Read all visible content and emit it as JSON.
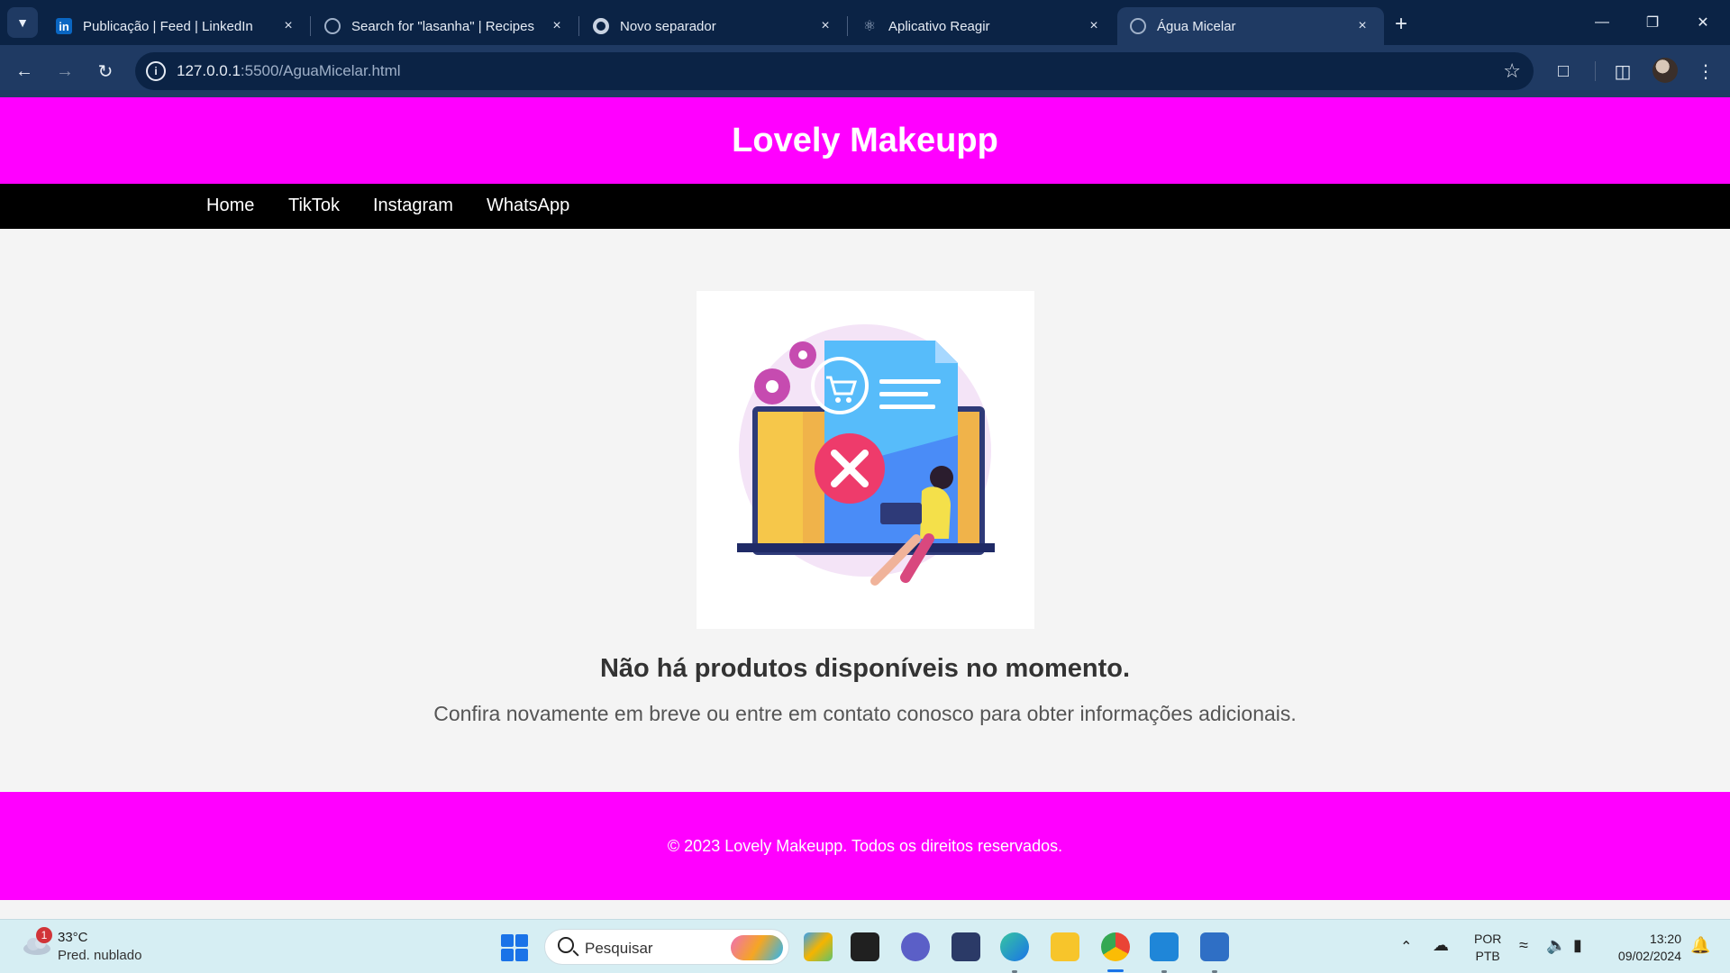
{
  "browser": {
    "tabs": [
      {
        "title": "Publicação | Feed | LinkedIn",
        "favicon": "linkedin-icon",
        "active": false
      },
      {
        "title": "Search for \"lasanha\" | Recipes",
        "favicon": "globe-icon",
        "active": false
      },
      {
        "title": "Novo separador",
        "favicon": "chrome-icon",
        "active": false
      },
      {
        "title": "Aplicativo Reagir",
        "favicon": "react-icon",
        "active": false
      },
      {
        "title": "Água Micelar",
        "favicon": "globe-icon",
        "active": true
      }
    ],
    "close_glyph": "×",
    "new_tab_glyph": "+",
    "address": {
      "host": "127.0.0.1",
      "path": ":5500/AguaMicelar.html"
    }
  },
  "page": {
    "site_title": "Lovely Makeupp",
    "nav": [
      {
        "label": "Home"
      },
      {
        "label": "TikTok"
      },
      {
        "label": "Instagram"
      },
      {
        "label": "WhatsApp"
      }
    ],
    "empty_state": {
      "title": "Não há produtos disponíveis no momento.",
      "subtitle": "Confira novamente em breve ou entre em contato conosco para obter informações adicionais."
    },
    "footer": "© 2023 Lovely Makeupp. Todos os direitos reservados.",
    "colors": {
      "brand": "#ff00ff",
      "nav": "#000000",
      "text": "#333333"
    }
  },
  "taskbar": {
    "weather": {
      "badge": "1",
      "temp": "33°C",
      "desc": "Pred. nublado"
    },
    "search_placeholder": "Pesquisar",
    "language": {
      "line1": "POR",
      "line2": "PTB"
    },
    "clock": {
      "time": "13:20",
      "date": "09/02/2024"
    }
  }
}
